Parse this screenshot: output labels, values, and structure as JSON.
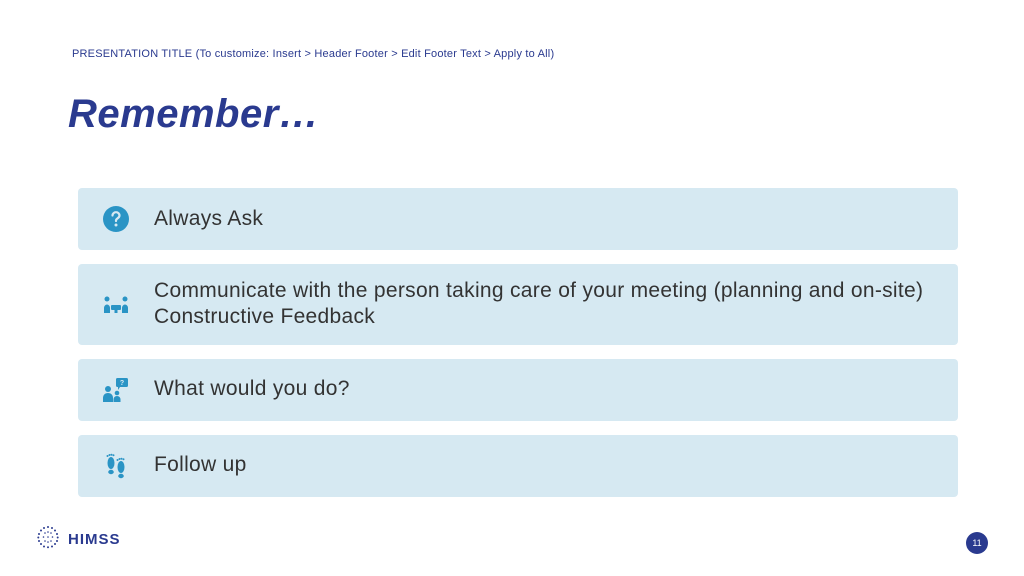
{
  "header_footer": "PRESENTATION TITLE (To customize: Insert > Header Footer > Edit Footer Text > Apply to All)",
  "title": "Remember…",
  "items": [
    {
      "icon": "question-circle-icon",
      "label": "Always Ask"
    },
    {
      "icon": "people-talk-icon",
      "label": "Communicate with the person taking care of your meeting (planning and on-site)  Constructive Feedback"
    },
    {
      "icon": "ask-audience-icon",
      "label": "What would you do?"
    },
    {
      "icon": "footprints-icon",
      "label": "Follow up"
    }
  ],
  "logo_text": "HIMSS",
  "page_number": "11",
  "accent_color": "#2a94c5",
  "brand_color": "#2a3a8f",
  "row_bg": "#d6e9f2"
}
